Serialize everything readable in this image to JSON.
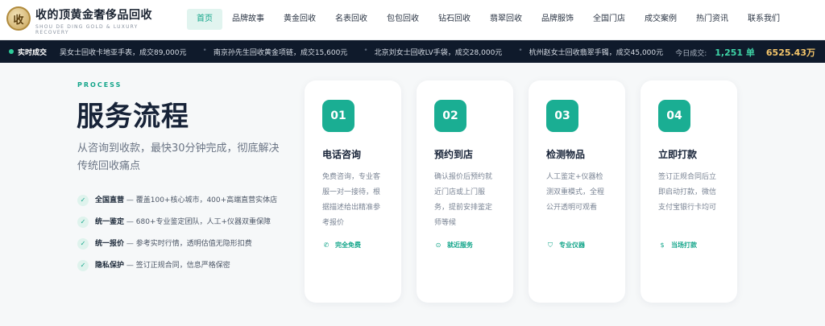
{
  "brand": {
    "logo_glyph": "收",
    "title": "收的顶黄金奢侈品回收",
    "subtitle": "SHOU DE DING GOLD & LUXURY RECOVERY"
  },
  "nav": {
    "items": [
      {
        "label": "首页",
        "active": true
      },
      {
        "label": "品牌故事"
      },
      {
        "label": "黄金回收"
      },
      {
        "label": "名表回收"
      },
      {
        "label": "包包回收"
      },
      {
        "label": "钻石回收"
      },
      {
        "label": "翡翠回收"
      },
      {
        "label": "品牌服饰"
      },
      {
        "label": "全国门店"
      },
      {
        "label": "成交案例"
      },
      {
        "label": "热门资讯"
      },
      {
        "label": "联系我们"
      }
    ]
  },
  "ticker": {
    "live_label": "实时成交",
    "items": [
      "吴女士回收卡地亚手表，成交89,000元",
      "南京孙先生回收黄金项链，成交15,600元",
      "北京刘女士回收LV手袋，成交28,000元",
      "杭州赵女士回收翡翠手镯，成交45,000元"
    ],
    "today_label": "今日成交:",
    "today_count": "1,251 单",
    "today_amount": "6525.43万"
  },
  "process": {
    "tag": "PROCESS",
    "title": "服务流程",
    "subtitle": "从咨询到收款，最快30分钟完成，彻底解决传统回收痛点",
    "features": [
      {
        "key": "全国直营",
        "text": " — 覆盖100+核心城市，400+高端直营实体店"
      },
      {
        "key": "统一鉴定",
        "text": " — 680+专业鉴定团队，人工+仪器双重保障"
      },
      {
        "key": "统一报价",
        "text": " — 参考实时行情，透明估值无隐形扣费"
      },
      {
        "key": "隐私保护",
        "text": " — 签订正规合同，信息严格保密"
      }
    ]
  },
  "cards": [
    {
      "num": "01",
      "title": "电话咨询",
      "desc": "免费咨询，专业客服一对一接待，根据描述给出精准参考报价",
      "tag": "完全免费",
      "icon": "phone-icon",
      "glyph": "✆"
    },
    {
      "num": "02",
      "title": "预约到店",
      "desc": "确认报价后预约就近门店或上门服务，提前安排鉴定师等候",
      "tag": "就近服务",
      "icon": "location-pin-icon",
      "glyph": "⊙"
    },
    {
      "num": "03",
      "title": "检测物品",
      "desc": "人工鉴定+仪器检测双重模式，全程公开透明可观看",
      "tag": "专业仪器",
      "icon": "shield-icon",
      "glyph": "⛉"
    },
    {
      "num": "04",
      "title": "立即打款",
      "desc": "签订正规合同后立即启动打款，微信支付宝银行卡均可",
      "tag": "当场打款",
      "icon": "dollar-icon",
      "glyph": "$"
    }
  ],
  "colors": {
    "accent": "#1aae93",
    "ticker_bg": "#0f1a2b",
    "today_count": "#3ed3a6",
    "today_amount": "#f5c66a"
  }
}
